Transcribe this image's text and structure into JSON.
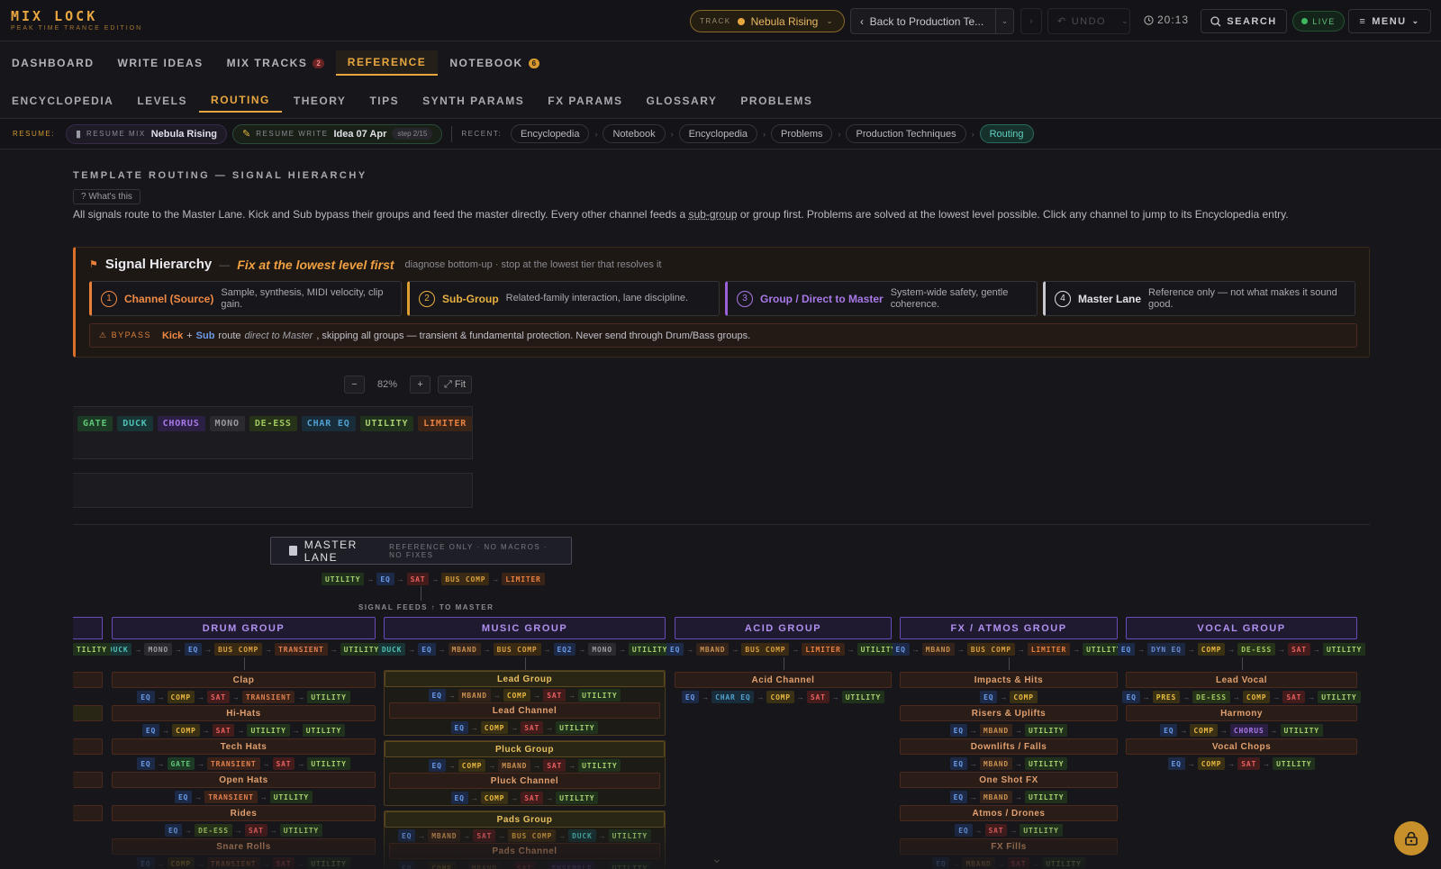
{
  "app": {
    "title": "MIX LOCK",
    "subtitle": "PEAK TIME TRANCE EDITION"
  },
  "header": {
    "track_label": "TRACK",
    "track_name": "Nebula Rising",
    "back_label": "Back to Production Te...",
    "undo_label": "UNDO",
    "clock": "20:13",
    "search_label": "SEARCH",
    "live_label": "LIVE",
    "menu_label": "MENU"
  },
  "main_tabs": [
    {
      "label": "DASHBOARD"
    },
    {
      "label": "WRITE IDEAS"
    },
    {
      "label": "MIX TRACKS",
      "badge": "2"
    },
    {
      "label": "REFERENCE"
    },
    {
      "label": "NOTEBOOK",
      "badge": "6"
    }
  ],
  "sub_tabs": [
    {
      "label": "ENCYCLOPEDIA"
    },
    {
      "label": "LEVELS"
    },
    {
      "label": "ROUTING"
    },
    {
      "label": "THEORY"
    },
    {
      "label": "TIPS"
    },
    {
      "label": "SYNTH PARAMS"
    },
    {
      "label": "FX PARAMS"
    },
    {
      "label": "GLOSSARY"
    },
    {
      "label": "PROBLEMS"
    }
  ],
  "resume": {
    "label": "RESUME:",
    "mix_key": "RESUME MIX",
    "mix_value": "Nebula Rising",
    "write_key": "RESUME WRITE",
    "write_value": "Idea 07 Apr",
    "write_step": "step 2/15",
    "recent_label": "RECENT:",
    "recent": [
      "Encyclopedia",
      "Notebook",
      "Encyclopedia",
      "Problems",
      "Production Techniques",
      "Routing"
    ],
    "sep": "›"
  },
  "content": {
    "title": "TEMPLATE ROUTING — SIGNAL HIERARCHY",
    "whats_this": "? What's this",
    "desc_a": "All signals route to the Master Lane. Kick and Sub bypass their groups and feed the master directly. Every other channel feeds a ",
    "desc_u": "sub-group",
    "desc_b": " or group first. Problems are solved at the lowest level possible. Click any channel to jump to its Encyclopedia entry."
  },
  "hierarchy": {
    "title": "Signal Hierarchy",
    "dash": "—",
    "emphasis": "Fix at the lowest level first",
    "hint": "diagnose bottom-up · stop at the lowest tier that resolves it",
    "tiers": [
      {
        "num": "1",
        "name": "Channel (Source)",
        "desc": "Sample, synthesis, MIDI velocity, clip gain."
      },
      {
        "num": "2",
        "name": "Sub-Group",
        "desc": "Related-family interaction, lane discipline."
      },
      {
        "num": "3",
        "name": "Group / Direct to Master",
        "desc": "System-wide safety, gentle coherence."
      },
      {
        "num": "4",
        "name": "Master Lane",
        "desc": "Reference only — not what makes it sound good."
      }
    ],
    "bypass_label": "BYPASS",
    "bypass_kick": "Kick",
    "bypass_plus": "+",
    "bypass_sub": "Sub",
    "bypass_route": "route",
    "bypass_direct": "direct to Master",
    "bypass_rest": ", skipping all groups — transient & fundamental protection. Never send through Drum/Bass groups."
  },
  "zoom": {
    "minus": "−",
    "value": "82%",
    "plus": "+",
    "fit": "⤢ Fit"
  },
  "macro_chips": [
    "GATE",
    "DUCK",
    "CHORUS",
    "MONO",
    "DE-ESS",
    "CHAR EQ",
    "UTILITY",
    "LIMITER"
  ],
  "master": {
    "title": "MASTER LANE",
    "subtitle": "REFERENCE ONLY · NO MACROS · NO FIXES",
    "chain": [
      "UTILITY",
      "EQ",
      "SAT",
      "BUS COMP",
      "LIMITER"
    ],
    "feeds_label": "SIGNAL FEEDS ↑ TO MASTER"
  },
  "groups": [
    {
      "name": "DRUM GROUP",
      "chain": [
        "DUCK",
        "MONO",
        "EQ",
        "BUS COMP",
        "TRANSIENT",
        "UTILITY"
      ],
      "channels": [
        {
          "name": "Clap",
          "chain": [
            "EQ",
            "COMP",
            "SAT",
            "TRANSIENT",
            "UTILITY"
          ]
        },
        {
          "name": "Hi-Hats",
          "chain": [
            "EQ",
            "COMP",
            "SAT",
            "UTILITY",
            "UTILITY"
          ]
        },
        {
          "name": "Tech Hats",
          "chain": [
            "EQ",
            "GATE",
            "TRANSIENT",
            "SAT",
            "UTILITY"
          ]
        },
        {
          "name": "Open Hats",
          "chain": [
            "EQ",
            "TRANSIENT",
            "UTILITY"
          ]
        },
        {
          "name": "Rides",
          "chain": [
            "EQ",
            "DE-ESS",
            "SAT",
            "UTILITY"
          ]
        },
        {
          "name": "Snare Rolls",
          "chain": [
            "EQ",
            "COMP",
            "TRANSIENT",
            "SAT",
            "UTILITY"
          ]
        }
      ]
    },
    {
      "name": "MUSIC GROUP",
      "chain": [
        "DUCK",
        "EQ",
        "MBAND",
        "BUS COMP",
        "EQ2",
        "MONO",
        "UTILITY"
      ],
      "subgroups": [
        {
          "name": "Lead Group",
          "chain": [
            "EQ",
            "MBAND",
            "COMP",
            "SAT",
            "UTILITY"
          ],
          "channel": "Lead Channel",
          "channel_chain": [
            "EQ",
            "COMP",
            "SAT",
            "UTILITY"
          ]
        },
        {
          "name": "Pluck Group",
          "chain": [
            "EQ",
            "COMP",
            "MBAND",
            "SAT",
            "UTILITY"
          ],
          "channel": "Pluck Channel",
          "channel_chain": [
            "EQ",
            "COMP",
            "SAT",
            "UTILITY"
          ]
        },
        {
          "name": "Pads Group",
          "chain": [
            "EQ",
            "MBAND",
            "SAT",
            "BUS COMP",
            "DUCK",
            "UTILITY"
          ],
          "channel": "Pads Channel",
          "channel_chain": [
            "EQ",
            "COMP",
            "MBAND",
            "SAT",
            "ENSEMBLE",
            "UTILITY"
          ]
        }
      ]
    },
    {
      "name": "ACID GROUP",
      "chain": [
        "EQ",
        "MBAND",
        "BUS COMP",
        "LIMITER",
        "UTILITY"
      ],
      "channels": [
        {
          "name": "Acid Channel",
          "chain": [
            "EQ",
            "CHAR EQ",
            "COMP",
            "SAT",
            "UTILITY"
          ]
        }
      ]
    },
    {
      "name": "FX / ATMOS GROUP",
      "chain": [
        "EQ",
        "MBAND",
        "BUS COMP",
        "LIMITER",
        "UTILITY"
      ],
      "channels": [
        {
          "name": "Impacts & Hits",
          "chain": [
            "EQ",
            "COMP"
          ]
        },
        {
          "name": "Risers & Uplifts",
          "chain": [
            "EQ",
            "MBAND",
            "UTILITY"
          ]
        },
        {
          "name": "Downlifts / Falls",
          "chain": [
            "EQ",
            "MBAND",
            "UTILITY"
          ]
        },
        {
          "name": "One Shot FX",
          "chain": [
            "EQ",
            "MBAND",
            "UTILITY"
          ]
        },
        {
          "name": "Atmos / Drones",
          "chain": [
            "EQ",
            "SAT",
            "UTILITY"
          ]
        },
        {
          "name": "FX Fills",
          "chain": [
            "EQ",
            "MBAND",
            "SAT",
            "UTILITY"
          ]
        }
      ]
    },
    {
      "name": "VOCAL GROUP",
      "chain": [
        "EQ",
        "DYN EQ",
        "COMP",
        "DE-ESS",
        "SAT",
        "UTILITY"
      ],
      "channels": [
        {
          "name": "Lead Vocal",
          "chain": [
            "EQ",
            "PRES",
            "DE-ESS",
            "COMP",
            "SAT",
            "UTILITY"
          ]
        },
        {
          "name": "Harmony",
          "chain": [
            "EQ",
            "COMP",
            "CHORUS",
            "UTILITY"
          ]
        },
        {
          "name": "Vocal Chops",
          "chain": [
            "EQ",
            "COMP",
            "SAT",
            "UTILITY"
          ]
        }
      ]
    }
  ],
  "left_partial_chain": [
    "TILITY"
  ],
  "colors": {
    "accent": "#e8a640",
    "group": "#b090f0",
    "live": "#3fb860",
    "bypass": "#d8702a"
  }
}
